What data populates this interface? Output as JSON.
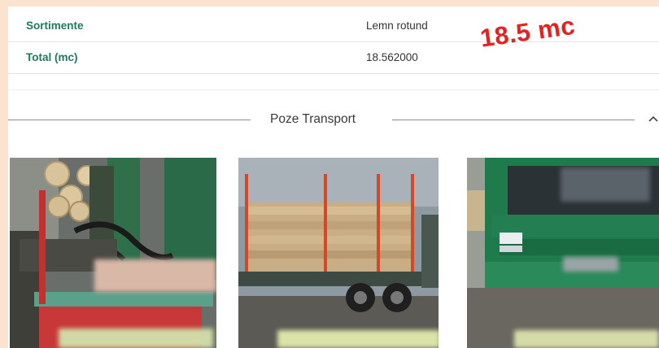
{
  "details": {
    "sortimente": {
      "label": "Sortimente",
      "value": "Lemn rotund"
    },
    "total": {
      "label": "Total (mc)",
      "value": "18.562000"
    }
  },
  "annotation": {
    "text": "18.5 mc",
    "color": "#e32222"
  },
  "section": {
    "title": "Poze Transport",
    "collapse_icon": "chevron-up-icon"
  },
  "photos": [
    {
      "subject": "crane loader with logs"
    },
    {
      "subject": "truck trailer loaded with round logs"
    },
    {
      "subject": "front of green truck"
    }
  ],
  "colors": {
    "label_green": "#1f7a5c",
    "truck_green": "#1f7a4c",
    "background": "#fbe3cf"
  }
}
